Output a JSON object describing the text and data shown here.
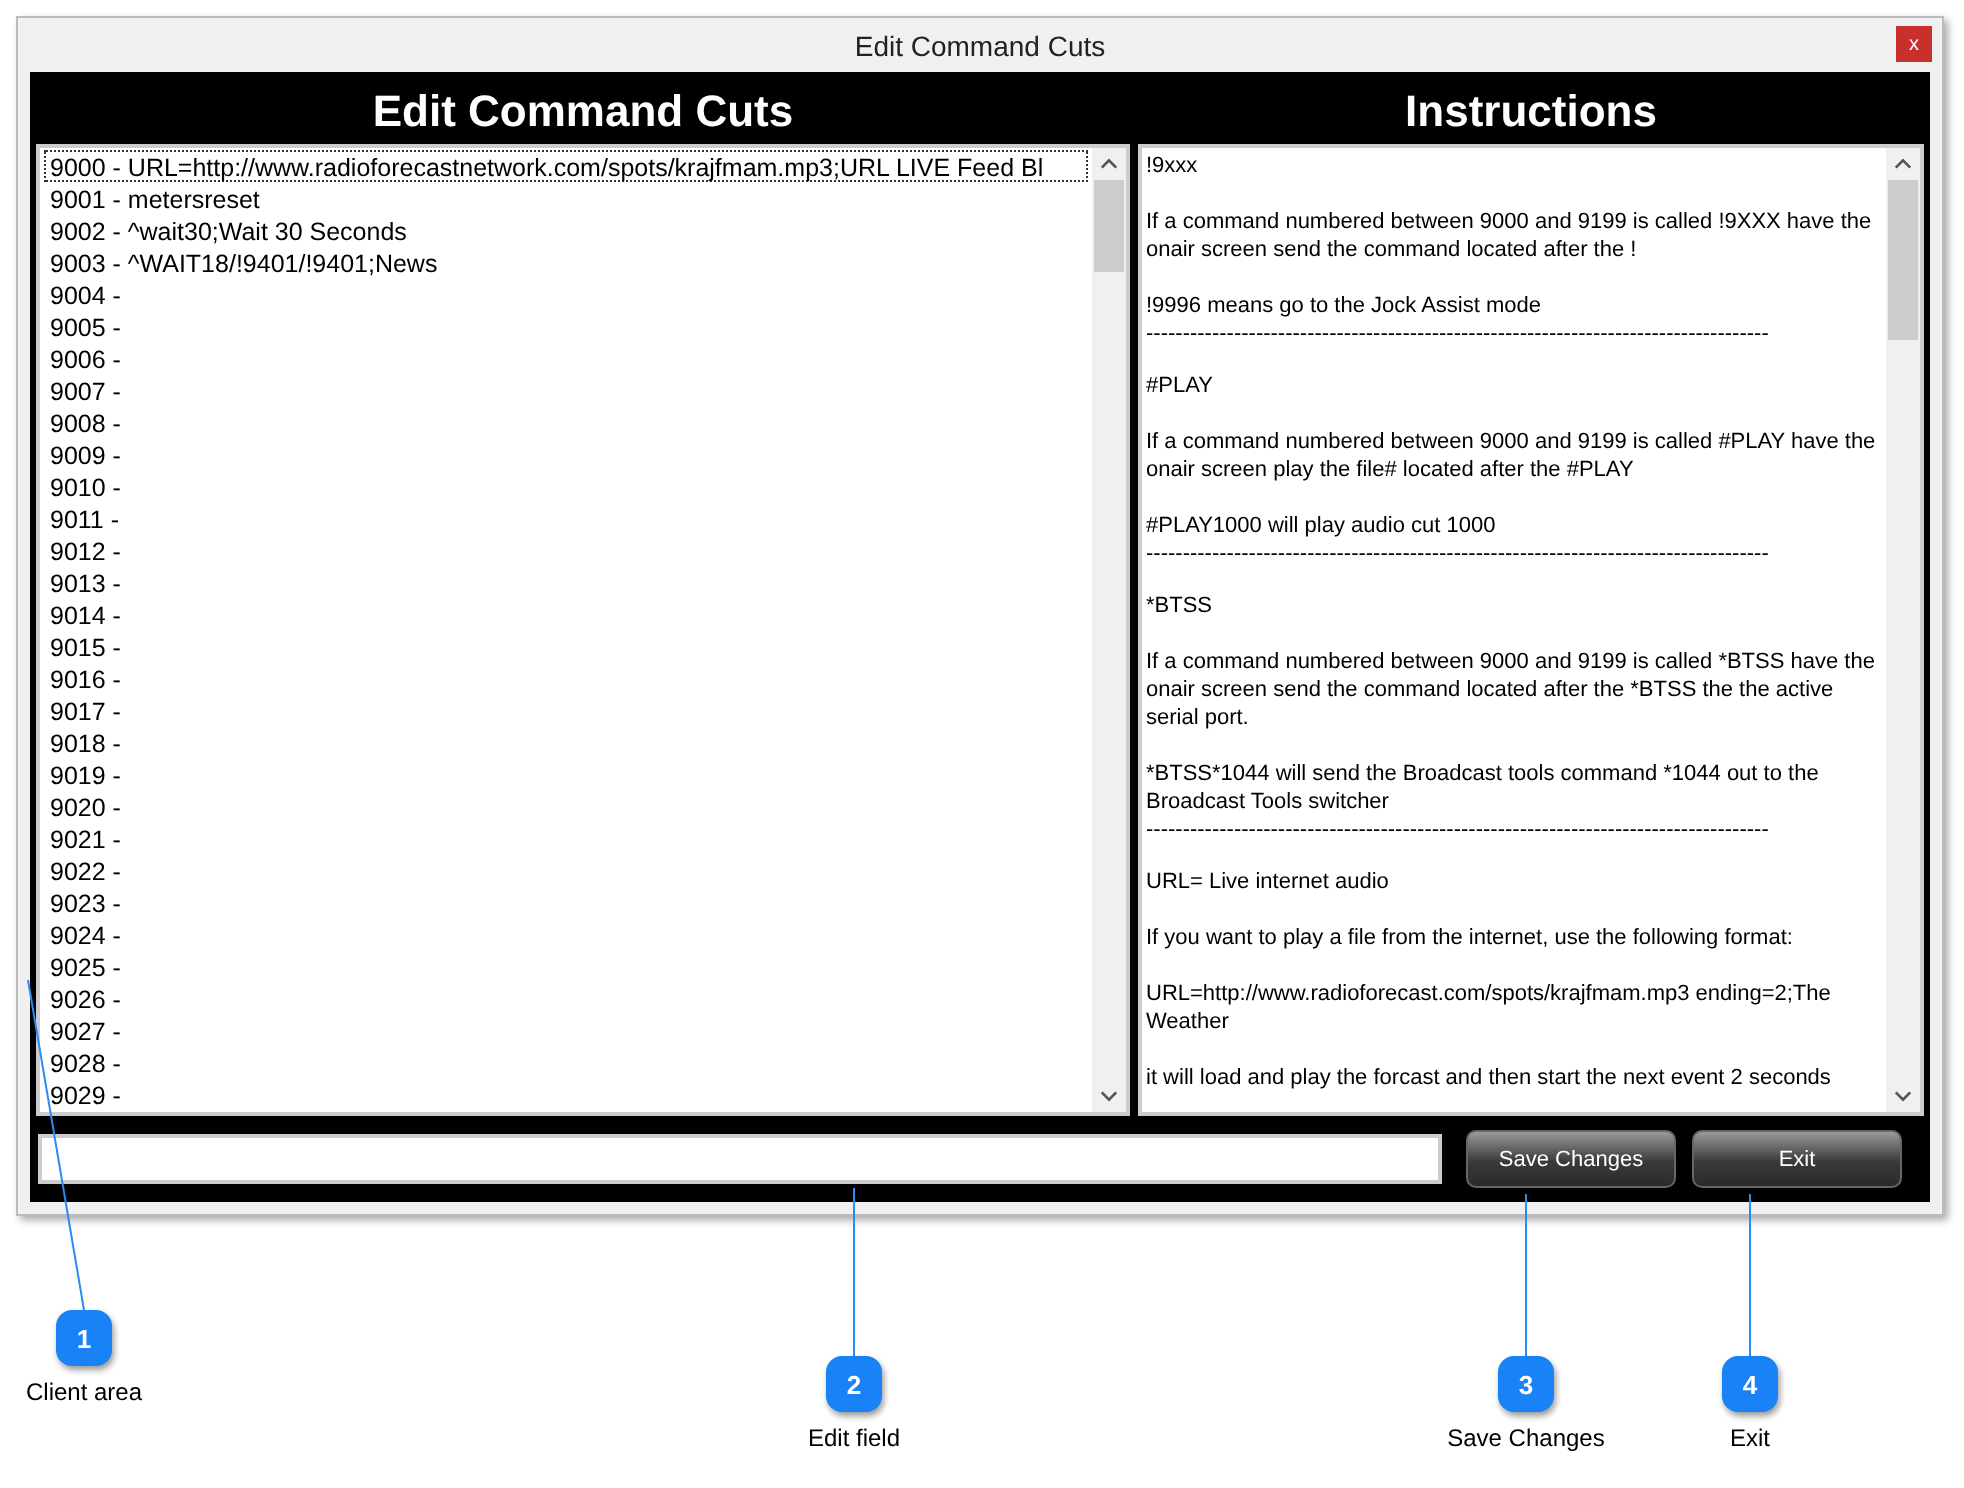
{
  "window": {
    "title": "Edit Command Cuts",
    "close": "x"
  },
  "cuts_panel": {
    "heading": "Edit Command Cuts",
    "items": [
      {
        "text": "9000 - URL=http://www.radioforecastnetwork.com/spots/krajfmam.mp3;URL LIVE Feed Bl",
        "selected": true
      },
      {
        "text": "9001 - metersreset",
        "selected": false
      },
      {
        "text": "9002 - ^wait30;Wait 30 Seconds",
        "selected": false
      },
      {
        "text": "9003 - ^WAIT18/!9401/!9401;News",
        "selected": false
      },
      {
        "text": "9004 -",
        "selected": false
      },
      {
        "text": "9005 -",
        "selected": false
      },
      {
        "text": "9006 -",
        "selected": false
      },
      {
        "text": "9007 -",
        "selected": false
      },
      {
        "text": "9008 -",
        "selected": false
      },
      {
        "text": "9009 -",
        "selected": false
      },
      {
        "text": "9010 -",
        "selected": false
      },
      {
        "text": "9011 -",
        "selected": false
      },
      {
        "text": "9012 -",
        "selected": false
      },
      {
        "text": "9013 -",
        "selected": false
      },
      {
        "text": "9014 -",
        "selected": false
      },
      {
        "text": "9015 -",
        "selected": false
      },
      {
        "text": "9016 -",
        "selected": false
      },
      {
        "text": "9017 -",
        "selected": false
      },
      {
        "text": "9018 -",
        "selected": false
      },
      {
        "text": "9019 -",
        "selected": false
      },
      {
        "text": "9020 -",
        "selected": false
      },
      {
        "text": "9021 -",
        "selected": false
      },
      {
        "text": "9022 -",
        "selected": false
      },
      {
        "text": "9023 -",
        "selected": false
      },
      {
        "text": "9024 -",
        "selected": false
      },
      {
        "text": "9025 -",
        "selected": false
      },
      {
        "text": "9026 -",
        "selected": false
      },
      {
        "text": "9027 -",
        "selected": false
      },
      {
        "text": "9028 -",
        "selected": false
      },
      {
        "text": "9029 -",
        "selected": false
      }
    ]
  },
  "instructions_panel": {
    "heading": "Instructions",
    "blocks": [
      {
        "kind": "text",
        "text": "!9xxx"
      },
      {
        "kind": "text",
        "text": "If a command numbered between 9000 and 9199 is called !9XXX have the onair screen send the command located after the !"
      },
      {
        "kind": "text",
        "text": "!9996 means go to the Jock Assist mode"
      },
      {
        "kind": "rule",
        "text": "-------------------------------------------------------------------------------------"
      },
      {
        "kind": "text",
        "text": "#PLAY"
      },
      {
        "kind": "text",
        "text": "If a command numbered between 9000 and 9199 is called #PLAY have the onair screen play the file# located after the #PLAY"
      },
      {
        "kind": "text",
        "text": "#PLAY1000 will play audio cut 1000"
      },
      {
        "kind": "rule",
        "text": "-------------------------------------------------------------------------------------"
      },
      {
        "kind": "text",
        "text": "*BTSS"
      },
      {
        "kind": "text",
        "text": "If a command numbered between 9000 and 9199 is called *BTSS have the onair screen send the command located after the *BTSS the the active serial port."
      },
      {
        "kind": "text",
        "text": "*BTSS*1044 will send the Broadcast tools command *1044 out to the Broadcast Tools switcher"
      },
      {
        "kind": "rule",
        "text": "-------------------------------------------------------------------------------------"
      },
      {
        "kind": "text",
        "text": "URL= Live internet audio"
      },
      {
        "kind": "text",
        "text": "If you want to play a file from the internet, use the following format:"
      },
      {
        "kind": "text",
        "text": "URL=http://www.radioforecast.com/spots/krajfmam.mp3 ending=2;The Weather"
      },
      {
        "kind": "text",
        "text": "it will load and play the forcast and then start the next event 2 seconds"
      }
    ]
  },
  "buttons": [
    "Save Changes",
    "Exit"
  ],
  "callouts": [
    {
      "number": "1",
      "label": "Client area"
    },
    {
      "number": "2",
      "label": "Edit field"
    },
    {
      "number": "3",
      "label": "Save Changes"
    },
    {
      "number": "4",
      "label": "Exit"
    }
  ]
}
